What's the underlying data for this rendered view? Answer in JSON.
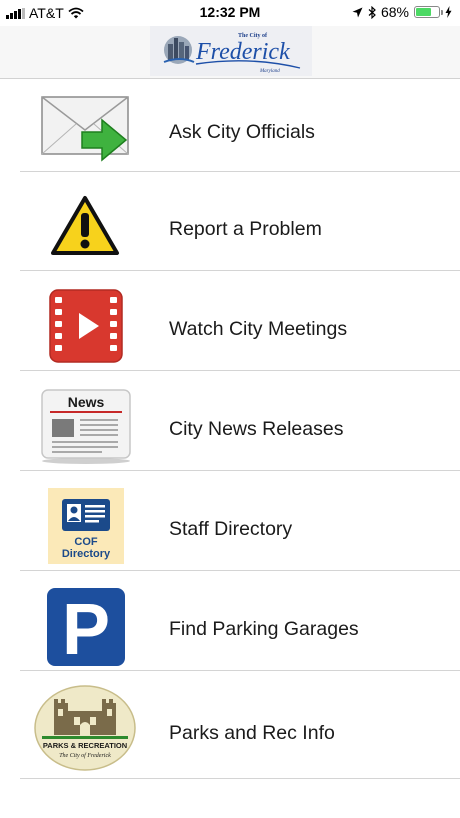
{
  "status_bar": {
    "carrier": "AT&T",
    "time": "12:32 PM",
    "battery_percent": "68%",
    "battery_level": 0.68
  },
  "header": {
    "logo_text": "Frederick",
    "logo_small_top": "The City of",
    "logo_small_bottom": "Maryland"
  },
  "menu": {
    "items": [
      {
        "label": "Ask City Officials",
        "icon": "email-arrow-icon"
      },
      {
        "label": "Report a Problem",
        "icon": "warning-icon"
      },
      {
        "label": "Watch City Meetings",
        "icon": "video-icon"
      },
      {
        "label": "City News Releases",
        "icon": "newspaper-icon"
      },
      {
        "label": "Staff Directory",
        "icon": "directory-icon"
      },
      {
        "label": "Find Parking Garages",
        "icon": "parking-icon"
      },
      {
        "label": "Parks and Rec Info",
        "icon": "parks-rec-icon"
      }
    ],
    "news_icon_text": "News",
    "directory_icon_line1": "COF",
    "directory_icon_line2": "Directory",
    "parking_icon_letter": "P",
    "parks_icon_line1": "PARKS & RECREATION",
    "parks_icon_line2": "The City of Frederick"
  },
  "colors": {
    "warning_yellow": "#f7d21c",
    "video_red": "#d8382e",
    "parking_blue": "#1d4f9e",
    "directory_blue": "#1b4a8a",
    "directory_bg": "#fbe9b8",
    "parks_green": "#2e8b2e",
    "email_arrow_green": "#3fb23f"
  }
}
